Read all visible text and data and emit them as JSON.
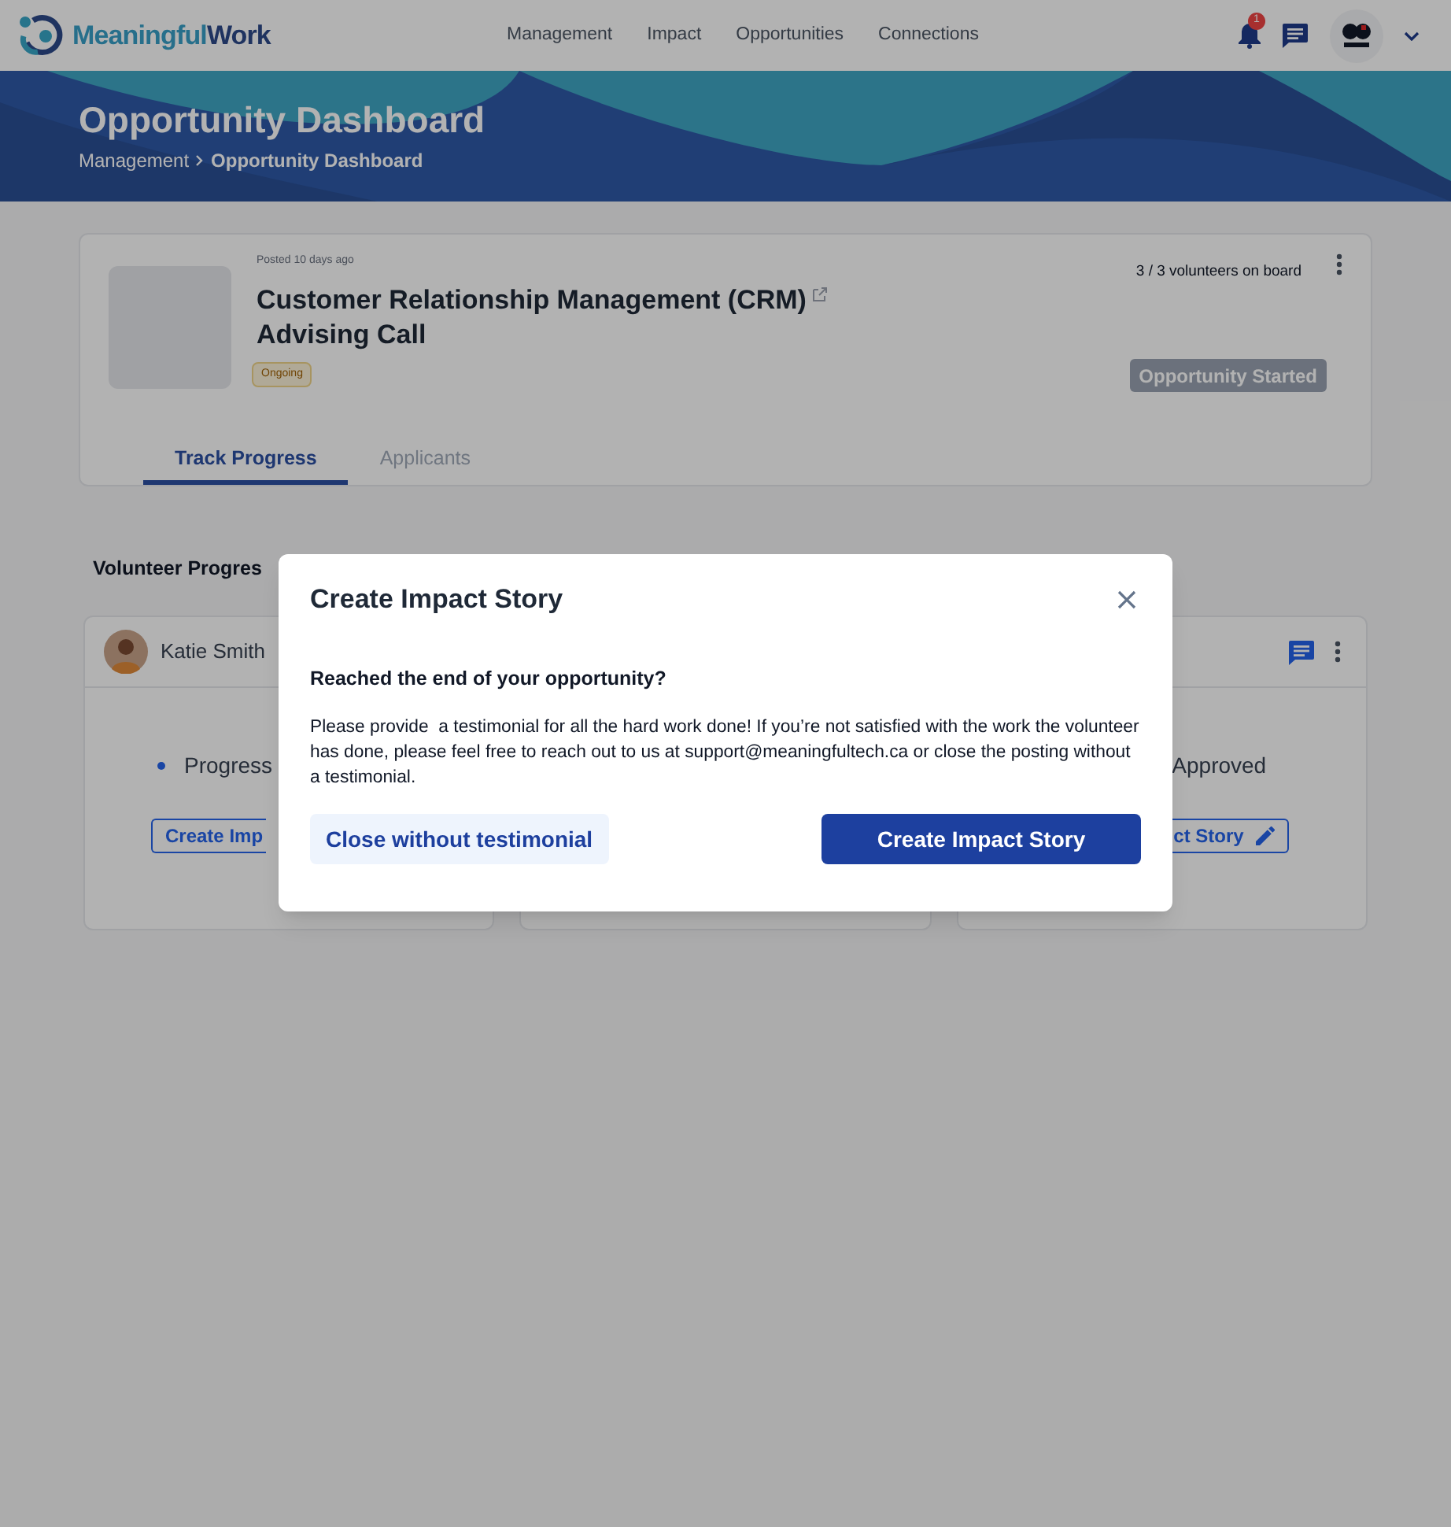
{
  "nav": {
    "brand": [
      "Meaningful",
      "Work"
    ],
    "links": [
      {
        "label": "Management"
      },
      {
        "label": "Impact"
      },
      {
        "label": "Opportunities"
      },
      {
        "label": "Connections"
      }
    ],
    "notification_count": "1"
  },
  "header": {
    "title": "Opportunity Dashboard",
    "breadcrumb": [
      "Management",
      "Opportunity Dashboard"
    ]
  },
  "opportunity": {
    "posted": "Posted 10 days ago",
    "title_lines": [
      "Customer Relationship Management (CRM)",
      "Advising Call"
    ],
    "status": "Ongoing",
    "volunteers": "3 / 3 volunteers on board",
    "action": {
      "label": "Opportunity Started",
      "disabled": true
    },
    "tabs": [
      {
        "label": "Track Progress",
        "selected": true
      },
      {
        "label": "Applicants",
        "selected": false
      }
    ]
  },
  "section_title": "Volunteer Progres",
  "volunteer_cards": [
    {
      "kind": "left",
      "name": "Katie Smith",
      "status": "Progress",
      "button": "Create Imp"
    },
    {
      "kind": "covered"
    },
    {
      "kind": "right",
      "status": "Approved",
      "button": "ct Story"
    }
  ],
  "modal": {
    "title": "Create Impact Story",
    "heading": "Reached the end of your opportunity?",
    "body": "Please provide  a testimonial for all the hard work done! If you’re not satisfied with the work the volunteer has done, please feel free to reach out to us at support@meaningfultech.ca or close the posting without a testimonial.",
    "buttons": [
      {
        "label": "Close without testimonial",
        "kind": "secondary"
      },
      {
        "label": "Create Impact Story",
        "kind": "primary"
      }
    ]
  }
}
